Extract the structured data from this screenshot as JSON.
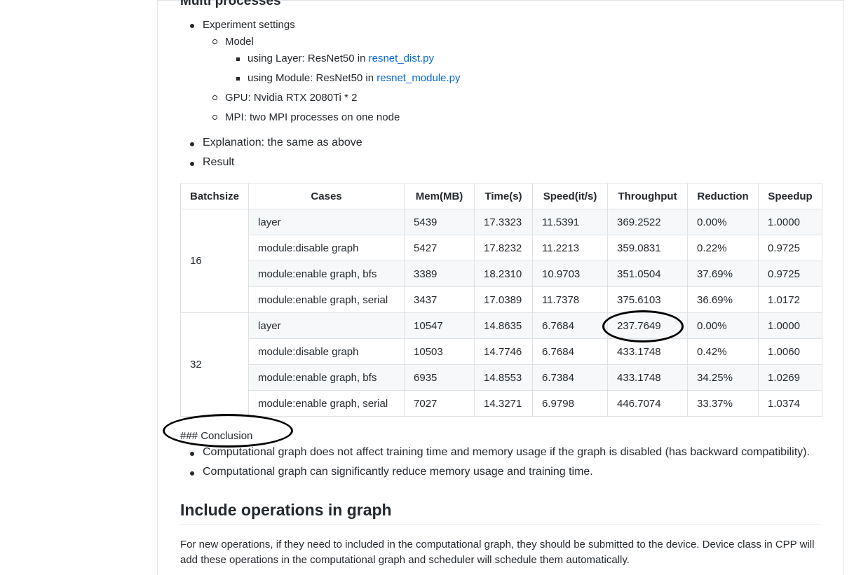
{
  "section_title": "Multi processes",
  "settings": {
    "label": "Experiment settings",
    "model_label": "Model",
    "model_items": [
      {
        "text": "using Layer: ResNet50 in ",
        "link": "resnet_dist.py"
      },
      {
        "text": "using Module: ResNet50 in ",
        "link": "resnet_module.py"
      }
    ],
    "gpu": "GPU: Nvidia RTX 2080Ti * 2",
    "mpi": "MPI: two MPI processes on one node"
  },
  "explanation": "Explanation: the same as above",
  "result_label": "Result",
  "table": {
    "headers": [
      "Batchsize",
      "Cases",
      "Mem(MB)",
      "Time(s)",
      "Speed(it/s)",
      "Throughput",
      "Reduction",
      "Speedup"
    ],
    "groups": [
      {
        "batchsize": "16",
        "rows": [
          [
            "layer",
            "5439",
            "17.3323",
            "11.5391",
            "369.2522",
            "0.00%",
            "1.0000"
          ],
          [
            "module:disable graph",
            "5427",
            "17.8232",
            "11.2213",
            "359.0831",
            "0.22%",
            "0.9725"
          ],
          [
            "module:enable graph, bfs",
            "3389",
            "18.2310",
            "10.9703",
            "351.0504",
            "37.69%",
            "0.9725"
          ],
          [
            "module:enable graph, serial",
            "3437",
            "17.0389",
            "11.7378",
            "375.6103",
            "36.69%",
            "1.0172"
          ]
        ]
      },
      {
        "batchsize": "32",
        "rows": [
          [
            "layer",
            "10547",
            "14.8635",
            "6.7684",
            "237.7649",
            "0.00%",
            "1.0000"
          ],
          [
            "module:disable graph",
            "10503",
            "14.7746",
            "6.7684",
            "433.1748",
            "0.42%",
            "1.0060"
          ],
          [
            "module:enable graph, bfs",
            "6935",
            "14.8553",
            "6.7384",
            "433.1748",
            "34.25%",
            "1.0269"
          ],
          [
            "module:enable graph, serial",
            "7027",
            "14.3271",
            "6.9798",
            "446.7074",
            "33.37%",
            "1.0374"
          ]
        ]
      }
    ]
  },
  "conclusion_raw": "### Conclusion",
  "conclusions": [
    "Computational graph does not affect training time and memory usage if the graph is disabled (has backward compatibility).",
    "Computational graph can significantly reduce memory usage and training time."
  ],
  "include_heading": "Include operations in graph",
  "include_paragraph": "For new operations, if they need to included in the computational graph, they should be submitted to the device. Device class in CPP will add these operations in the computational graph and scheduler will schedule them automatically."
}
